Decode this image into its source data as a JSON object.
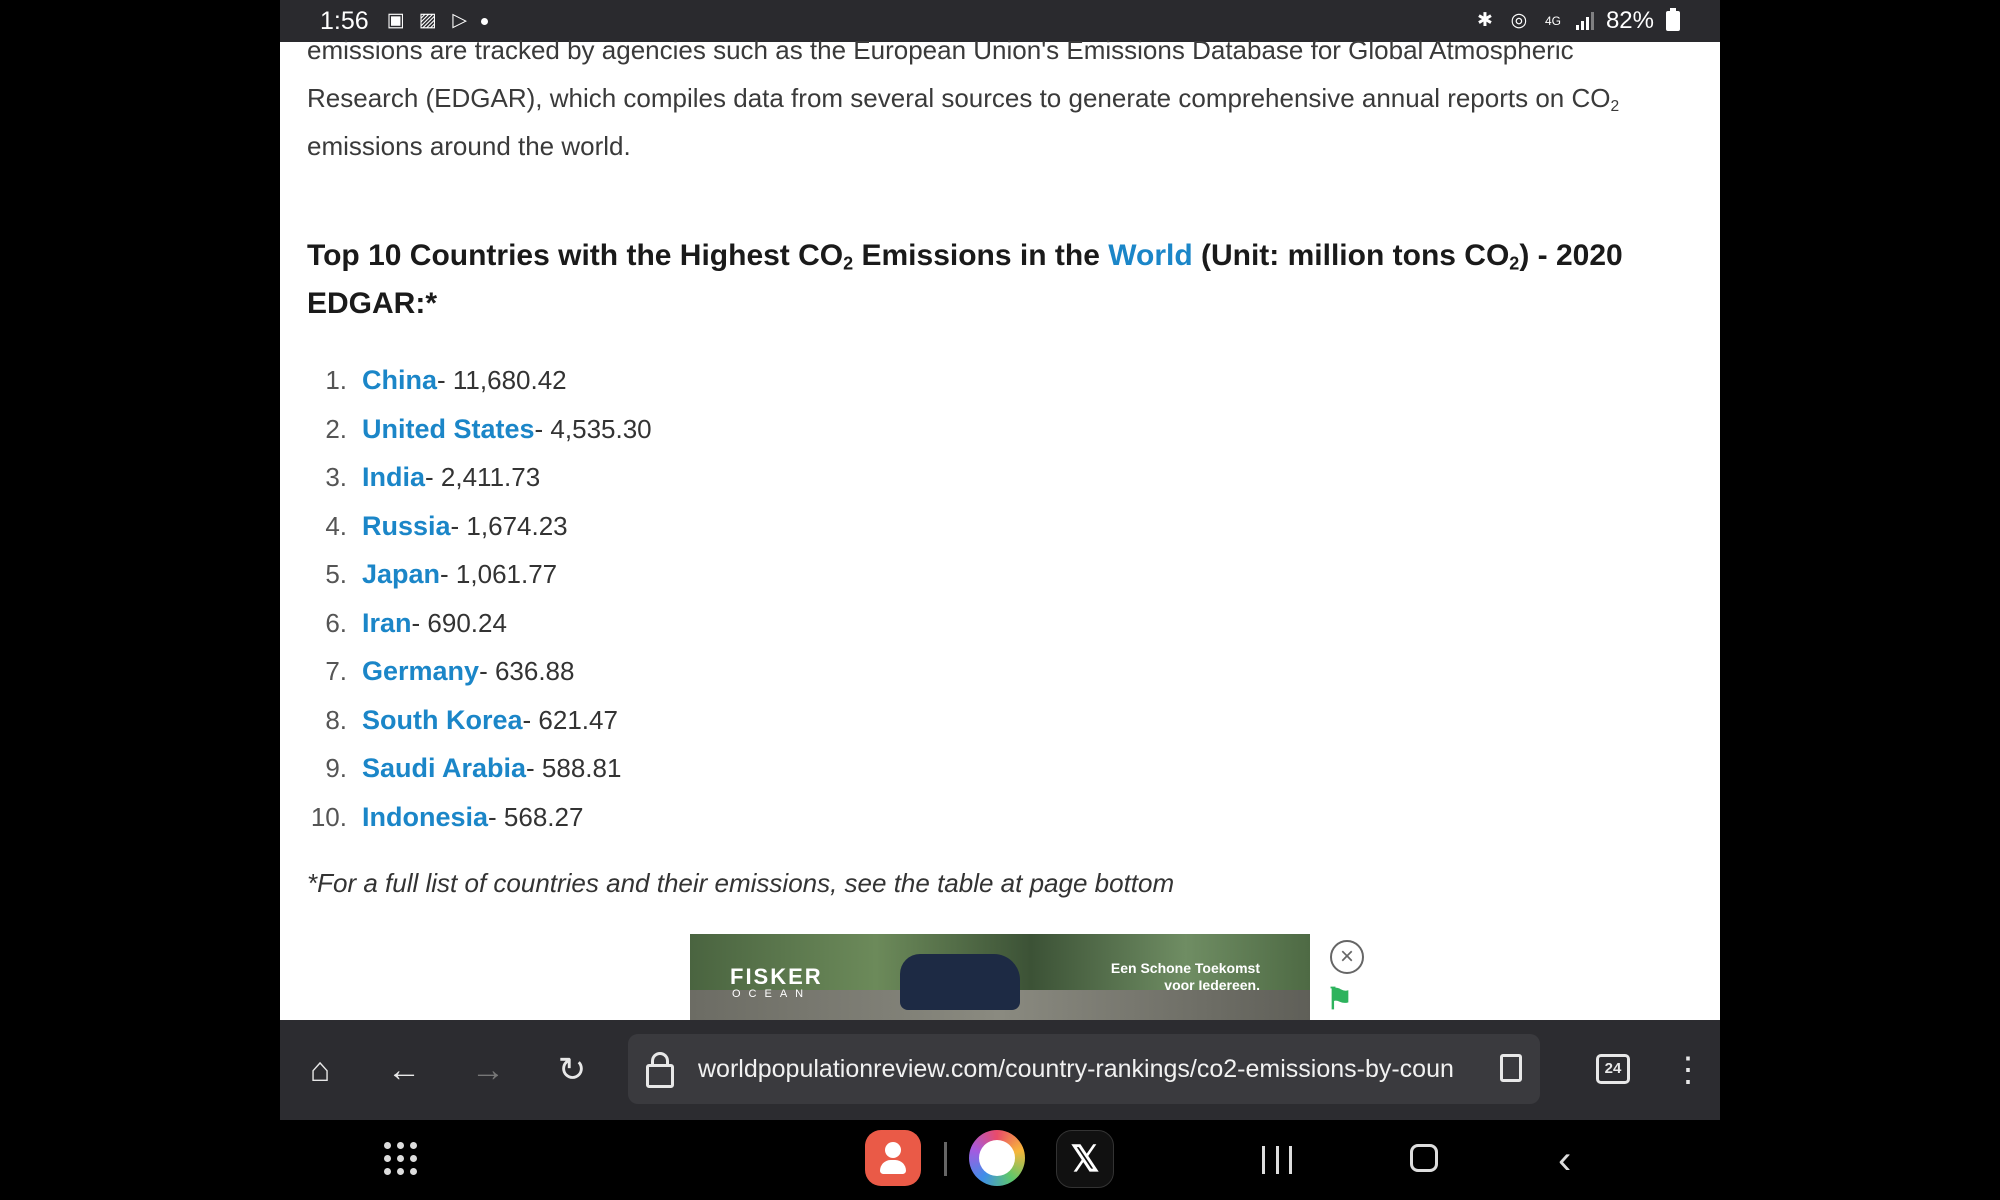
{
  "status_bar": {
    "time": "1:56",
    "battery": "82%",
    "icons": [
      "gallery-icon",
      "photos-icon",
      "play-store-icon",
      "bluetooth-icon",
      "hotspot-icon",
      "4g-icon",
      "signal-icon"
    ]
  },
  "article": {
    "intro_line1": "emissions are tracked by agencies such as the European Union's Emissions Database for Global Atmospheric",
    "intro_line2_a": "Research (EDGAR), which compiles data from several sources to generate comprehensive annual reports on CO",
    "intro_line2_sub": "2",
    "intro_line3": "emissions around the world.",
    "heading_part1": "Top 10 Countries with the Highest CO",
    "heading_sub1": "2",
    "heading_part2": " Emissions in the ",
    "heading_link": "World",
    "heading_part3": " (Unit: million tons CO",
    "heading_sub2": "2",
    "heading_part4": ") - 2020 EDGAR:*",
    "list": [
      {
        "num": "1.",
        "country": "China",
        "value": " - 11,680.42"
      },
      {
        "num": "2.",
        "country": "United States",
        "value": " - 4,535.30"
      },
      {
        "num": "3.",
        "country": "India",
        "value": " - 2,411.73"
      },
      {
        "num": "4.",
        "country": "Russia",
        "value": " - 1,674.23"
      },
      {
        "num": "5.",
        "country": "Japan",
        "value": " - 1,061.77"
      },
      {
        "num": "6.",
        "country": "Iran",
        "value": " - 690.24"
      },
      {
        "num": "7.",
        "country": "Germany",
        "value": " - 636.88"
      },
      {
        "num": "8.",
        "country": "South Korea",
        "value": " - 621.47"
      },
      {
        "num": "9.",
        "country": "Saudi Arabia",
        "value": " - 588.81"
      },
      {
        "num": "10.",
        "country": "Indonesia",
        "value": " - 568.27"
      }
    ],
    "footnote": "*For a full list of countries and their emissions, see the table at page bottom"
  },
  "ad": {
    "brand": "FISKER",
    "brand_sub": "OCEAN",
    "tagline_line1": "Een Schone Toekomst",
    "tagline_line2": "voor Iedereen."
  },
  "browser": {
    "url": "worldpopulationreview.com/country-rankings/co2-emissions-by-coun",
    "tab_count": "24"
  },
  "colors": {
    "link": "#1b86c8",
    "toolbar": "#2c2c30",
    "status_bar": "#2a2a2e"
  }
}
